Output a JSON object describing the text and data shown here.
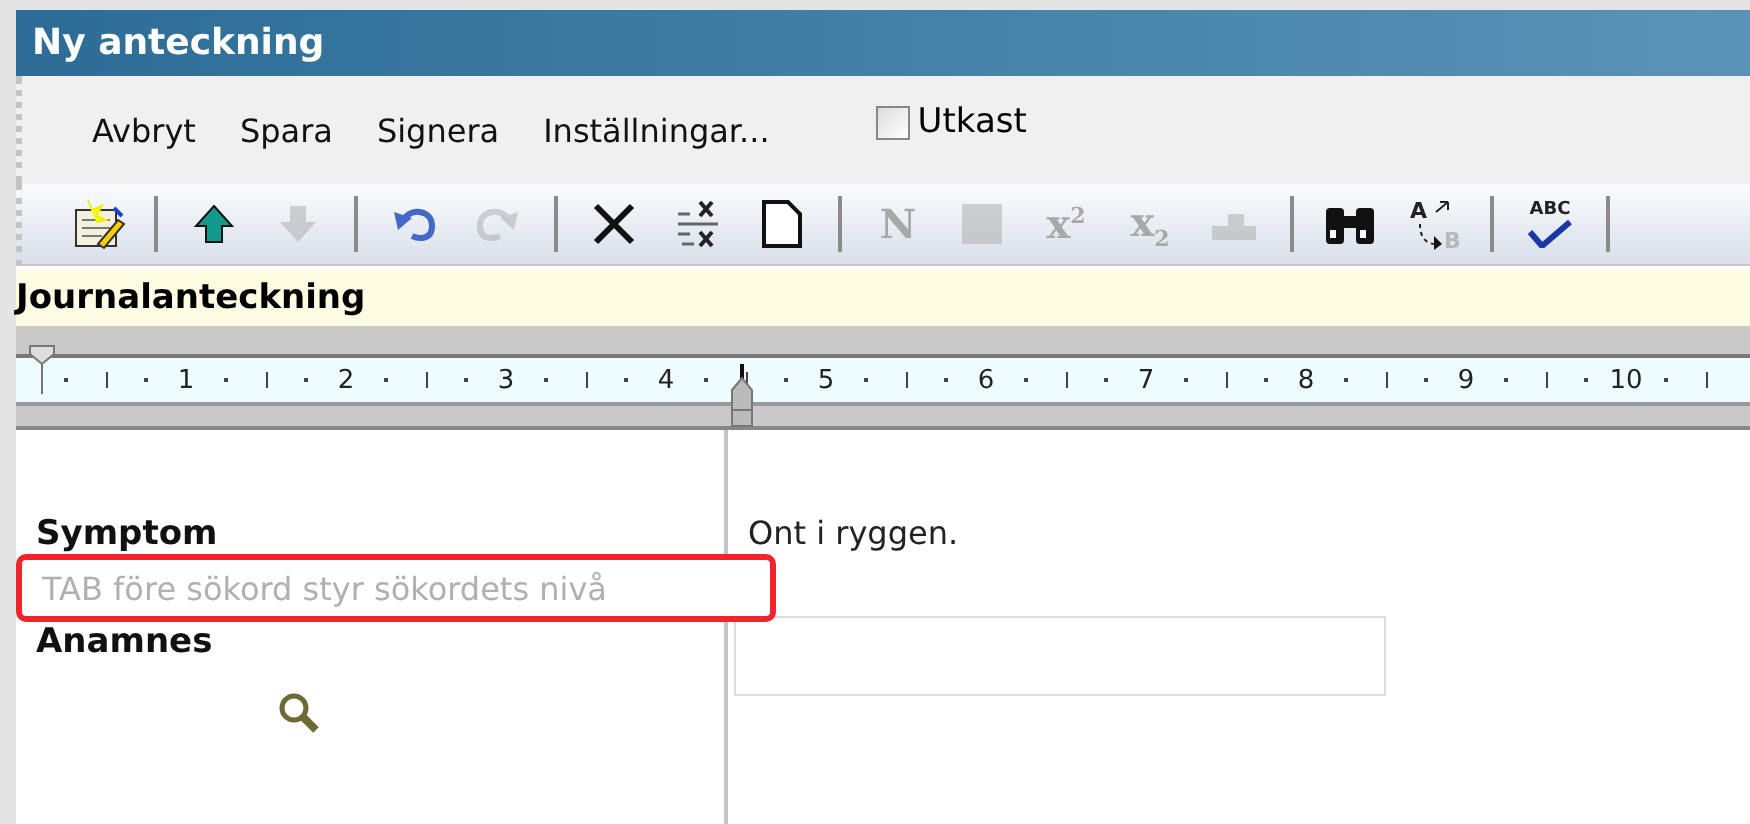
{
  "window": {
    "title": "Ny anteckning"
  },
  "menu": [
    {
      "label": "Avbryt"
    },
    {
      "label": "Spara"
    },
    {
      "label": "Signera"
    },
    {
      "label": "Inställningar..."
    }
  ],
  "draft_checkbox": {
    "label": "Utkast",
    "checked": false
  },
  "toolbar": [
    {
      "kind": "new-note",
      "disabled": false
    },
    {
      "kind": "separator"
    },
    {
      "kind": "arrow-up",
      "disabled": false
    },
    {
      "kind": "arrow-down",
      "disabled": true
    },
    {
      "kind": "separator"
    },
    {
      "kind": "undo",
      "disabled": false
    },
    {
      "kind": "redo",
      "disabled": true
    },
    {
      "kind": "separator"
    },
    {
      "kind": "delete",
      "disabled": false
    },
    {
      "kind": "delete-lines",
      "disabled": false
    },
    {
      "kind": "page",
      "disabled": false
    },
    {
      "kind": "separator"
    },
    {
      "kind": "text",
      "label": "N",
      "disabled": true
    },
    {
      "kind": "square",
      "disabled": true
    },
    {
      "kind": "text",
      "label": "x$^{2}$",
      "disabled": true
    },
    {
      "kind": "text",
      "label": "x$_{2}$",
      "disabled": true
    },
    {
      "kind": "stamp",
      "disabled": true
    },
    {
      "kind": "separator"
    },
    {
      "kind": "binoculars",
      "disabled": false
    },
    {
      "kind": "replace",
      "from": "A",
      "to": "B",
      "disabled": false
    },
    {
      "kind": "separator"
    },
    {
      "kind": "spellcheck",
      "label": "ABC",
      "disabled": false
    },
    {
      "kind": "separator"
    }
  ],
  "section_header": "Journalanteckning",
  "ruler": {
    "labels": [
      "1",
      "2",
      "3",
      "4",
      "5",
      "6",
      "7",
      "8",
      "9",
      "10"
    ]
  },
  "journal": {
    "symptom": {
      "label": "Symptom",
      "text": "Ont i ryggen."
    },
    "search_field": {
      "placeholder": "TAB före sökord styr sökordets nivå",
      "highlighted": true
    },
    "anamnes": {
      "label": "Anamnes"
    }
  }
}
